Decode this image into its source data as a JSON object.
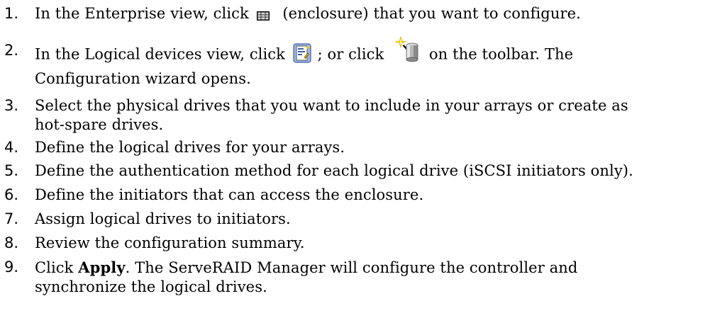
{
  "steps": [
    {
      "number": "1.",
      "parts": {
        "a": "In the Enterprise view, click",
        "icon": "enclosure-icon",
        "b": "(enclosure) that you want to configure."
      }
    },
    {
      "number": "2.",
      "parts": {
        "a": "In the Logical devices view, click",
        "icon1": "configure-icon",
        "b": "; or click",
        "icon2": "wizard-icon",
        "c": "on the toolbar. The",
        "line2": "Configuration wizard opens."
      }
    },
    {
      "number": "3.",
      "line1": "Select the physical drives that you want to include in your arrays or create as",
      "line2": "hot-spare drives."
    },
    {
      "number": "4.",
      "line1": "Define the logical drives for your arrays."
    },
    {
      "number": "5.",
      "line1": "Define the authentication method for each logical drive (iSCSI initiators only)."
    },
    {
      "number": "6.",
      "line1": "Define the initiators that can access the enclosure."
    },
    {
      "number": "7.",
      "line1": "Assign logical drives to initiators."
    },
    {
      "number": "8.",
      "line1": "Review the configuration summary."
    },
    {
      "number": "9.",
      "parts": {
        "a": "Click",
        "bold": "Apply",
        "b": ". The ServeRAID Manager will configure the controller and",
        "line2": "synchronize the logical drives."
      }
    }
  ]
}
